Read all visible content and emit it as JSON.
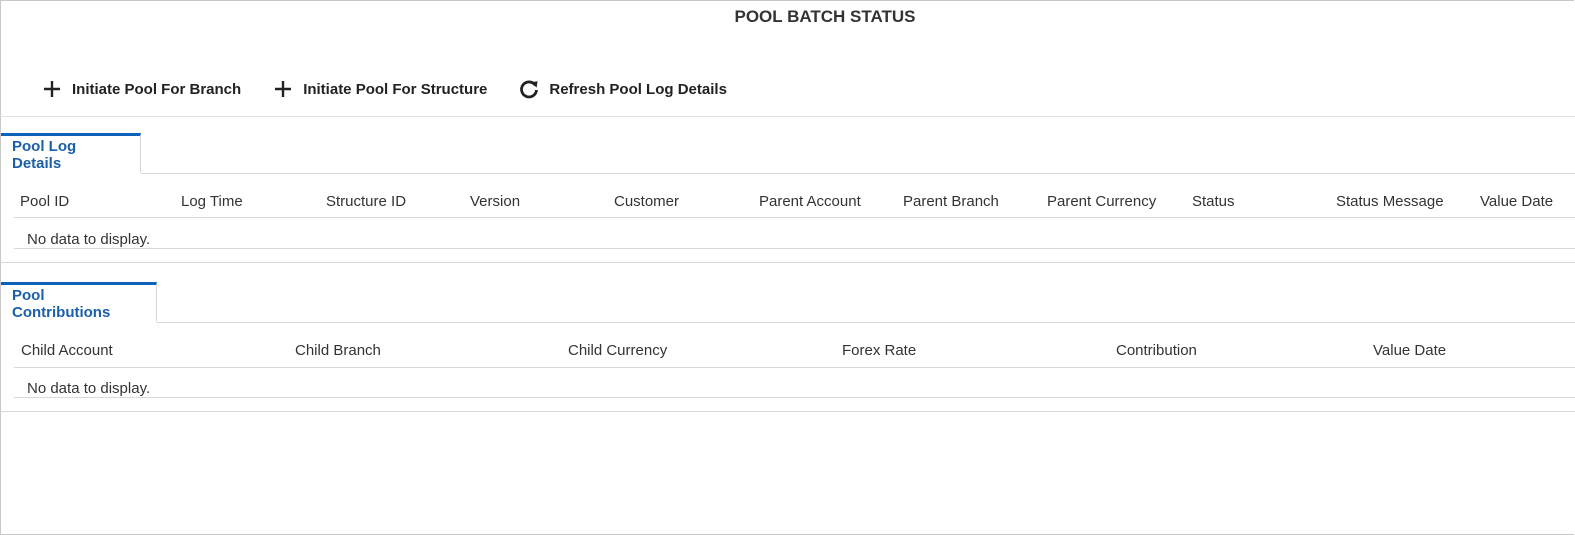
{
  "page": {
    "title": "POOL BATCH STATUS"
  },
  "toolbar": {
    "initiate_branch": "Initiate Pool For Branch",
    "initiate_structure": "Initiate Pool For Structure",
    "refresh": "Refresh Pool Log Details"
  },
  "pool_log": {
    "tab": "Pool Log Details",
    "columns": [
      "Pool ID",
      "Log Time",
      "Structure ID",
      "Version",
      "Customer",
      "Parent Account",
      "Parent Branch",
      "Parent Currency",
      "Status",
      "Status Message",
      "Value Date"
    ],
    "empty_text": "No data to display."
  },
  "pool_contrib": {
    "tab": "Pool Contributions",
    "columns": [
      "Child Account",
      "Child Branch",
      "Child Currency",
      "Forex Rate",
      "Contribution",
      "Value Date"
    ],
    "empty_text": "No data to display."
  },
  "colors": {
    "accent": "#0e63b8",
    "tab_text": "#1a5fa8"
  },
  "icons": {
    "add": "plus-icon",
    "refresh": "refresh-icon"
  }
}
